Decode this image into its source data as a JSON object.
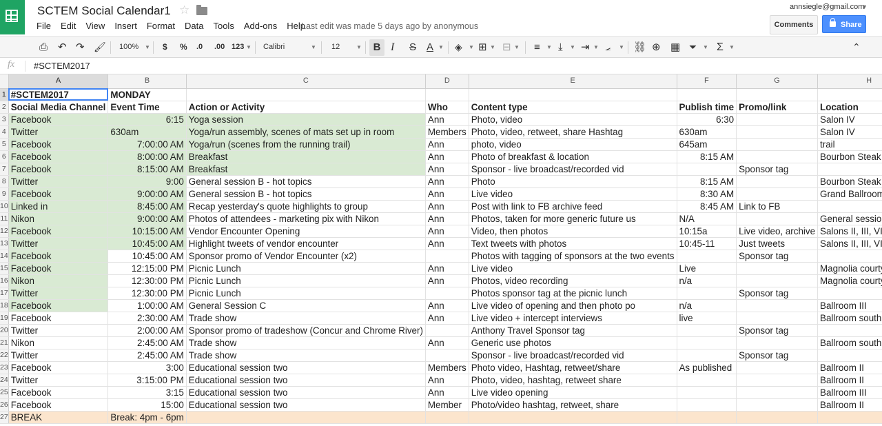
{
  "app": {
    "title": "SCTEM Social Calendar1",
    "account": "annsiegle@gmail.com",
    "last_edit": "Last edit was made 5 days ago by anonymous",
    "comments_label": "Comments",
    "share_label": "Share",
    "brand_color": "#1fa463",
    "share_color": "#4d90fe"
  },
  "menu": [
    "File",
    "Edit",
    "View",
    "Insert",
    "Format",
    "Data",
    "Tools",
    "Add-ons",
    "Help"
  ],
  "toolbar": {
    "zoom": "100%",
    "currency": "$",
    "percent": "%",
    "decrease_decimals": ".0",
    "increase_decimals": ".00",
    "more_formats": "123",
    "font": "Calibri",
    "font_size": "12",
    "bold": "B",
    "italic": "I",
    "strike": "S",
    "text_color": "A",
    "functions": "Σ"
  },
  "formula_bar": {
    "fx": "fx",
    "content": "#SCTEM2017"
  },
  "columns": [
    "A",
    "B",
    "C",
    "D",
    "E",
    "F",
    "G",
    "H"
  ],
  "rows": [
    {
      "n": "1",
      "cells": [
        "#SCTEM2017",
        "MONDAY",
        "",
        "",
        "",
        "",
        "",
        ""
      ]
    },
    {
      "n": "2",
      "cells": [
        "Social Media Channel",
        "Event Time",
        "Action or Activity",
        "Who",
        "Content type",
        "Publish time",
        "Promo/link",
        "Location"
      ]
    },
    {
      "n": "3",
      "cells": [
        "Facebook",
        "6:15",
        "Yoga session",
        "Ann",
        "Photo, video",
        "6:30",
        "",
        "Salon IV"
      ]
    },
    {
      "n": "4",
      "cells": [
        "Twitter",
        "630am",
        "Yoga/run assembly, scenes of mats set up in room",
        "Members",
        "Photo, video, retweet, share Hashtag",
        "630am",
        "",
        "Salon IV"
      ]
    },
    {
      "n": "5",
      "cells": [
        "Facebook",
        "7:00:00 AM",
        "Yoga/run (scenes from the running trail)",
        "Ann",
        "photo, video",
        "645am",
        "",
        "trail"
      ]
    },
    {
      "n": "6",
      "cells": [
        "Facebook",
        "8:00:00 AM",
        "Breakfast",
        "Ann",
        "Photo of breakfast & location",
        "8:15 AM",
        "",
        "Bourbon Steak"
      ]
    },
    {
      "n": "7",
      "cells": [
        "Facebook",
        "8:15:00 AM",
        "Breakfast",
        "Ann",
        "Sponsor - live broadcast/recorded vid",
        "",
        "Sponsor tag",
        ""
      ]
    },
    {
      "n": "8",
      "cells": [
        "Twitter",
        "9:00",
        "General session B  - hot topics",
        "Ann",
        "Photo",
        "8:15 AM",
        "",
        "Bourbon Steak"
      ]
    },
    {
      "n": "9",
      "cells": [
        "Facebook",
        "9:00:00 AM",
        "General session B  - hot topics",
        "Ann",
        "Live video",
        "8:30 AM",
        "",
        "Grand Ballroom III"
      ]
    },
    {
      "n": "10",
      "cells": [
        "Linked in",
        "8:45:00 AM",
        "Recap yesterday's quote highlights to group",
        "Ann",
        "Post with link to FB archive feed",
        "8:45 AM",
        "Link to FB",
        ""
      ]
    },
    {
      "n": "11",
      "cells": [
        "Nikon",
        "9:00:00 AM",
        "Photos of attendees - marketing pix with Nikon",
        "Ann",
        "Photos, taken for more generic future us",
        "N/A",
        "",
        "General session Ballroo"
      ]
    },
    {
      "n": "12",
      "cells": [
        "Facebook",
        "10:15:00 AM",
        "Vendor Encounter Opening",
        "Ann",
        "Video, then photos",
        "10:15a",
        "Live video, archive",
        "Salons II, III, VI and VII"
      ]
    },
    {
      "n": "13",
      "cells": [
        "Twitter",
        "10:45:00 AM",
        "Highlight tweets of vendor encounter",
        "Ann",
        "Text tweets with photos",
        "10:45-11",
        "Just tweets",
        "Salons II, III, VI and VII"
      ]
    },
    {
      "n": "14",
      "cells": [
        "Facebook",
        "10:45:00 AM",
        "Sponsor promo of Vendor Encounter (x2)",
        "",
        "Photos with tagging of sponsors at the two events",
        "",
        "Sponsor tag",
        ""
      ]
    },
    {
      "n": "15",
      "cells": [
        "Facebook",
        "12:15:00 PM",
        "Picnic Lunch",
        "Ann",
        "Live video",
        "Live",
        "",
        "Magnolia courtyard"
      ]
    },
    {
      "n": "16",
      "cells": [
        "Nikon",
        "12:30:00 PM",
        "Picnic Lunch",
        "Ann",
        "Photos, video recording",
        "n/a",
        "",
        "Magnolia courtyard"
      ]
    },
    {
      "n": "17",
      "cells": [
        "Twitter",
        "12:30:00 PM",
        "Picnic Lunch",
        "",
        "Photos sponsor tag at the picnic lunch",
        "",
        "Sponsor tag",
        ""
      ]
    },
    {
      "n": "18",
      "cells": [
        "Facebook",
        "1:00:00 AM",
        "General Session C",
        "Ann",
        "Live video of opening and then photo po",
        "n/a",
        "",
        "Ballroom III"
      ]
    },
    {
      "n": "19",
      "cells": [
        "Facebook",
        "2:30:00 AM",
        "Trade show",
        "Ann",
        "Live video + intercept interviews",
        "live",
        "",
        "Ballroom south foyer"
      ]
    },
    {
      "n": "20",
      "cells": [
        "Twitter",
        "2:00:00 AM",
        "Sponsor promo of tradeshow (Concur and Chrome River)",
        "",
        "Anthony Travel Sponsor tag",
        "",
        "Sponsor tag",
        ""
      ]
    },
    {
      "n": "21",
      "cells": [
        "Nikon",
        "2:45:00 AM",
        "Trade show",
        "Ann",
        "Generic use photos",
        "",
        "",
        "Ballroom south foyer"
      ]
    },
    {
      "n": "22",
      "cells": [
        "Twitter",
        "2:45:00 AM",
        "Trade show",
        "",
        "Sponsor - live broadcast/recorded vid",
        "",
        "Sponsor tag",
        ""
      ]
    },
    {
      "n": "23",
      "cells": [
        "Facebook",
        "3:00",
        "Educational session two",
        "Members",
        "Photo video, Hashtag, retweet/share",
        "As published",
        "",
        "Ballroom II"
      ]
    },
    {
      "n": "24",
      "cells": [
        "Twitter",
        "3:15:00 PM",
        "Educational session two",
        "Ann",
        "Photo, video, hashtag, retweet share",
        "",
        "",
        "Ballroom II"
      ]
    },
    {
      "n": "25",
      "cells": [
        "Facebook",
        "3:15",
        "Educational session two",
        "Ann",
        "Live video opening",
        "",
        "",
        "Ballroom III"
      ]
    },
    {
      "n": "26",
      "cells": [
        "Facebook",
        "15:00",
        "Educational session two",
        "Member",
        "Photo/video hashtag, retweet, share",
        "",
        "",
        "Ballroom II"
      ]
    },
    {
      "n": "27",
      "cells": [
        "BREAK",
        "Break: 4pm - 6pm",
        "",
        "",
        "",
        "",
        "",
        ""
      ]
    }
  ],
  "colors": {
    "highlight_green": "#d9ead3",
    "highlight_orange": "#fce5cd",
    "selection": "#4285f4"
  }
}
